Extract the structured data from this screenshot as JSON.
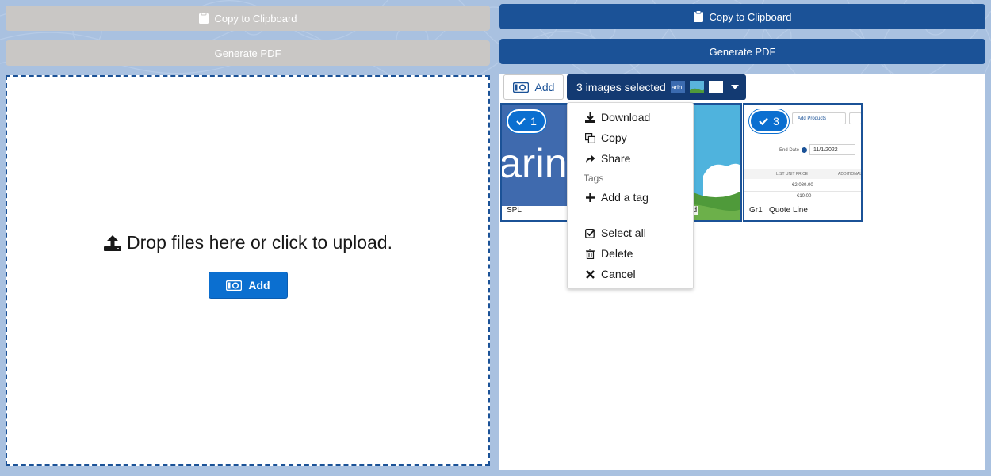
{
  "left": {
    "copy_label": "Copy to Clipboard",
    "pdf_label": "Generate PDF",
    "drop_message": "Drop files here or click to upload.",
    "add_label": "Add"
  },
  "right": {
    "copy_label": "Copy to Clipboard",
    "pdf_label": "Generate PDF",
    "add_label": "Add",
    "selected_label": "3 images selected",
    "tiles": [
      {
        "badge": "1",
        "label": "SPL",
        "logo_text": "arin"
      },
      {
        "label": "ound"
      },
      {
        "badge": "3",
        "label": "Gr1   Quote Line",
        "snippet": {
          "add_products": "Add Products",
          "end_date_label": "End Date",
          "end_date": "11/1/2022",
          "col_header_1": "LIST UNIT PRICE",
          "col_header_2": "ADDITIONAL",
          "price_1": "€2,080.00",
          "price_2": "€10.00"
        }
      }
    ],
    "menu": {
      "download": "Download",
      "copy": "Copy",
      "share": "Share",
      "tags_heading": "Tags",
      "add_tag": "Add a tag",
      "select_all": "Select all",
      "delete": "Delete",
      "cancel": "Cancel"
    }
  },
  "colors": {
    "brand": "#1b5297",
    "brand_dark": "#133a72",
    "button_blue": "#0b6fd0",
    "disabled": "#c9c7c5",
    "background": "#a9c1e0"
  }
}
